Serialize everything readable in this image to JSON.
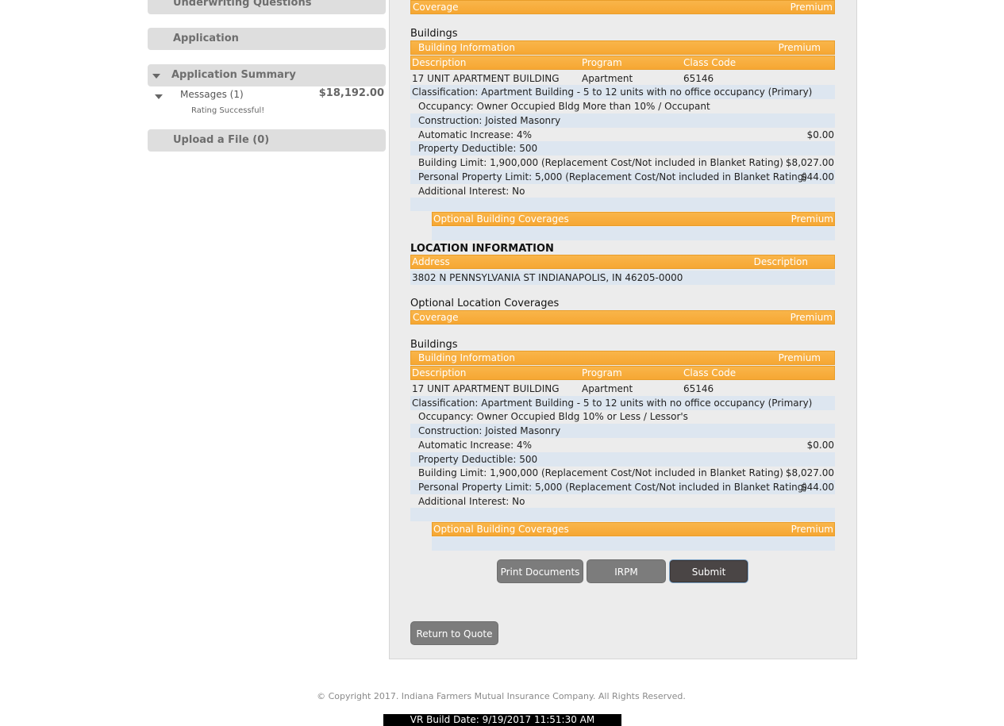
{
  "sidebar": {
    "underwriting_label": "Underwriting Questions",
    "application_label": "Application",
    "summary_label": "Application Summary",
    "messages_label": "Messages (1)",
    "total_premium": "$18,192.00",
    "rating_status": "Rating Successful!",
    "upload_label": "Upload a File (0)"
  },
  "block1": {
    "coverage_bar": {
      "coverage": "Coverage",
      "premium": "Premium"
    },
    "buildings_heading": "Buildings",
    "info_bar": {
      "label": "Building Information",
      "premium": "Premium"
    },
    "cols": {
      "description": "Description",
      "program": "Program",
      "class_code": "Class Code"
    },
    "building": {
      "description": "17 UNIT APARTMENT BUILDING",
      "program": "Apartment",
      "class_code": "65146"
    },
    "classification": "Classification: Apartment Building - 5 to 12 units with no office occupancy (Primary)",
    "occupancy": "Occupancy: Owner Occupied Bldg More than 10% / Occupant",
    "construction": "Construction: Joisted Masonry",
    "auto_increase": "Automatic Increase: 4%",
    "auto_increase_premium": "$0.00",
    "deductible": "Property Deductible: 500",
    "building_limit": "Building Limit: 1,900,000 (Replacement Cost/Not included in Blanket Rating)",
    "building_limit_premium": "$8,027.00",
    "pp_limit": "Personal Property Limit: 5,000 (Replacement Cost/Not included in Blanket Rating)",
    "pp_limit_premium": "$44.00",
    "additional_interest": "Additional Interest: No",
    "optional_bar": {
      "label": "Optional Building Coverages",
      "premium": "Premium"
    }
  },
  "location": {
    "heading": "LOCATION INFORMATION",
    "bar": {
      "address": "Address",
      "description": "Description"
    },
    "address": "3802 N PENNSYLVANIA ST INDIANAPOLIS, IN 46205-0000",
    "optional_heading": "Optional Location Coverages",
    "coverage_bar": {
      "coverage": "Coverage",
      "premium": "Premium"
    }
  },
  "block2": {
    "buildings_heading": "Buildings",
    "info_bar": {
      "label": "Building Information",
      "premium": "Premium"
    },
    "cols": {
      "description": "Description",
      "program": "Program",
      "class_code": "Class Code"
    },
    "building": {
      "description": "17 UNIT APARTMENT BUILDING",
      "program": "Apartment",
      "class_code": "65146"
    },
    "classification": "Classification: Apartment Building - 5 to 12 units with no office occupancy (Primary)",
    "occupancy": "Occupancy: Owner Occupied Bldg 10% or Less / Lessor's",
    "construction": "Construction: Joisted Masonry",
    "auto_increase": "Automatic Increase: 4%",
    "auto_increase_premium": "$0.00",
    "deductible": "Property Deductible: 500",
    "building_limit": "Building Limit: 1,900,000 (Replacement Cost/Not included in Blanket Rating)",
    "building_limit_premium": "$8,027.00",
    "pp_limit": "Personal Property Limit: 5,000 (Replacement Cost/Not included in Blanket Rating)",
    "pp_limit_premium": "$44.00",
    "additional_interest": "Additional Interest: No",
    "optional_bar": {
      "label": "Optional Building Coverages",
      "premium": "Premium"
    }
  },
  "actions": {
    "print_label": "Print Documents",
    "irpm_label": "IRPM",
    "submit_label": "Submit",
    "return_label": "Return to Quote"
  },
  "footer": {
    "copyright": "© Copyright 2017. Indiana Farmers Mutual Insurance Company. All Rights Reserved.",
    "build": "VR Build Date: 9/19/2017 11:51:30 AM"
  },
  "colors": {
    "accent_orange": "#f6a733",
    "row_shade": "#dde6f0",
    "panel_bg": "#ececec"
  }
}
